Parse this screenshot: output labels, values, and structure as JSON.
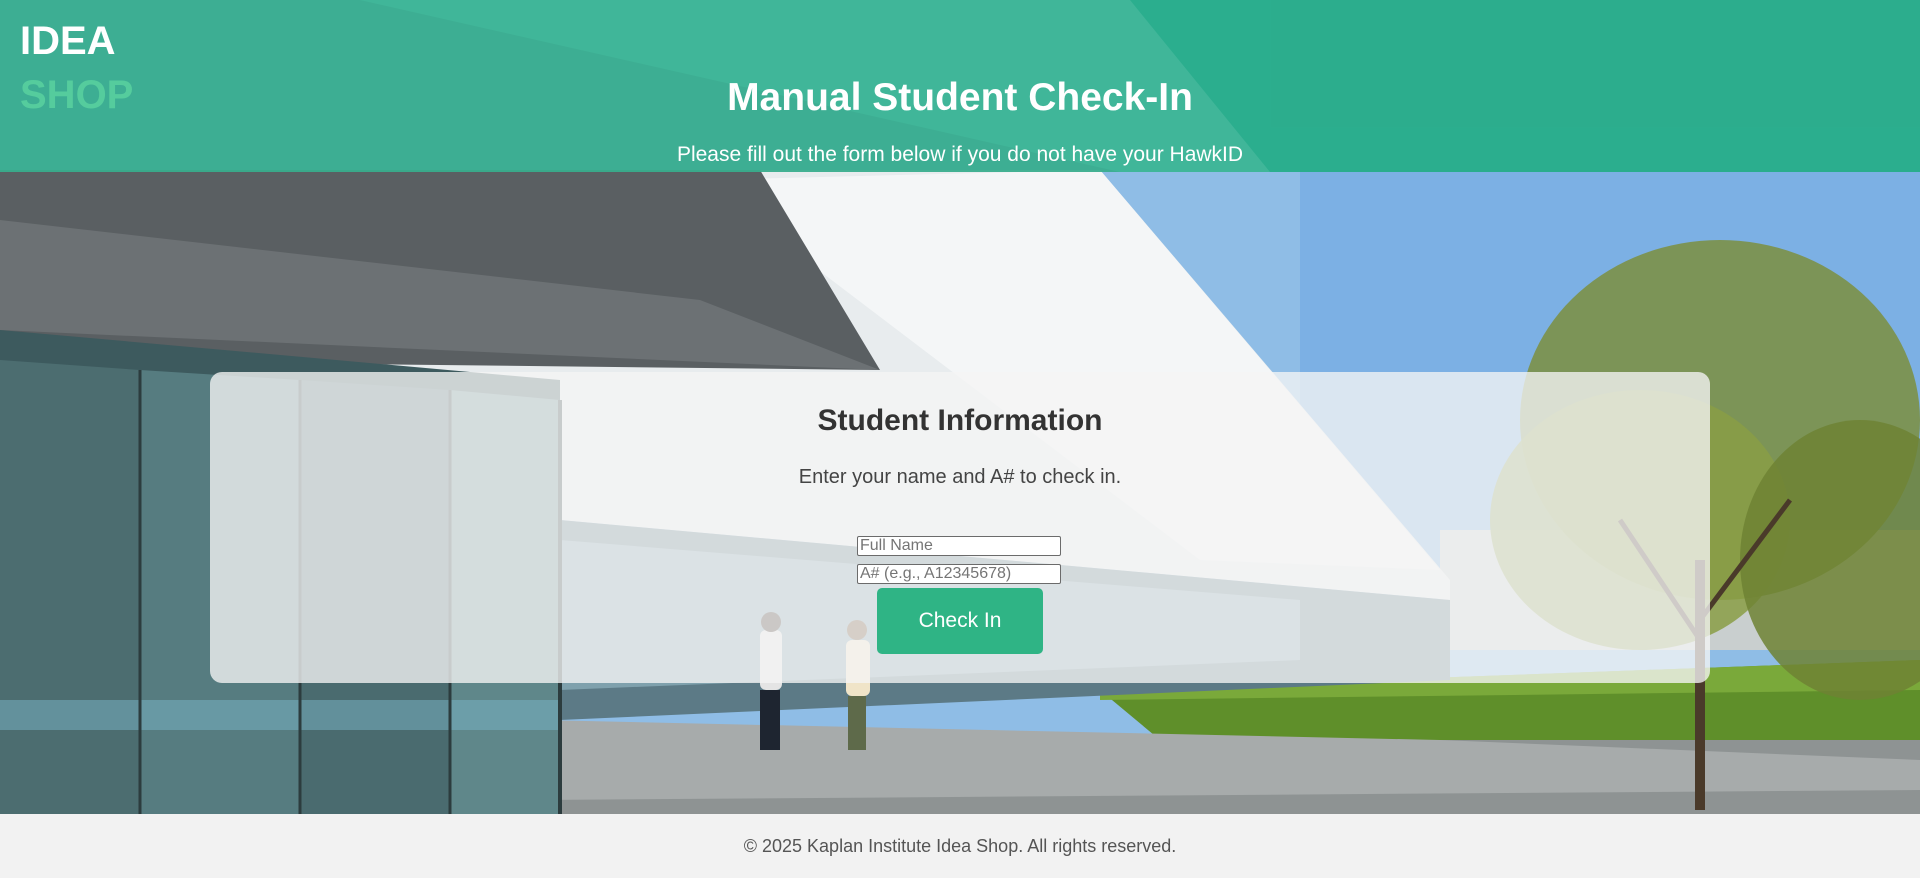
{
  "brand": {
    "logo_line1": "IDEA",
    "logo_line2": "SHOP",
    "primary_color": "#24ac86",
    "logo_accent_color": "#55cc9d"
  },
  "header": {
    "title": "Manual Student Check-In",
    "subtitle": "Please fill out the form below if you do not have your HawkID"
  },
  "form": {
    "title": "Student Information",
    "description": "Enter your name and A# to check in.",
    "name_placeholder": "Full Name",
    "name_value": "",
    "anumber_placeholder": "A# (e.g., A12345678)",
    "anumber_value": "",
    "submit_label": "Check In",
    "button_color": "#2fb485"
  },
  "footer": {
    "text": "© 2025 Kaplan Institute Idea Shop. All rights reserved."
  }
}
